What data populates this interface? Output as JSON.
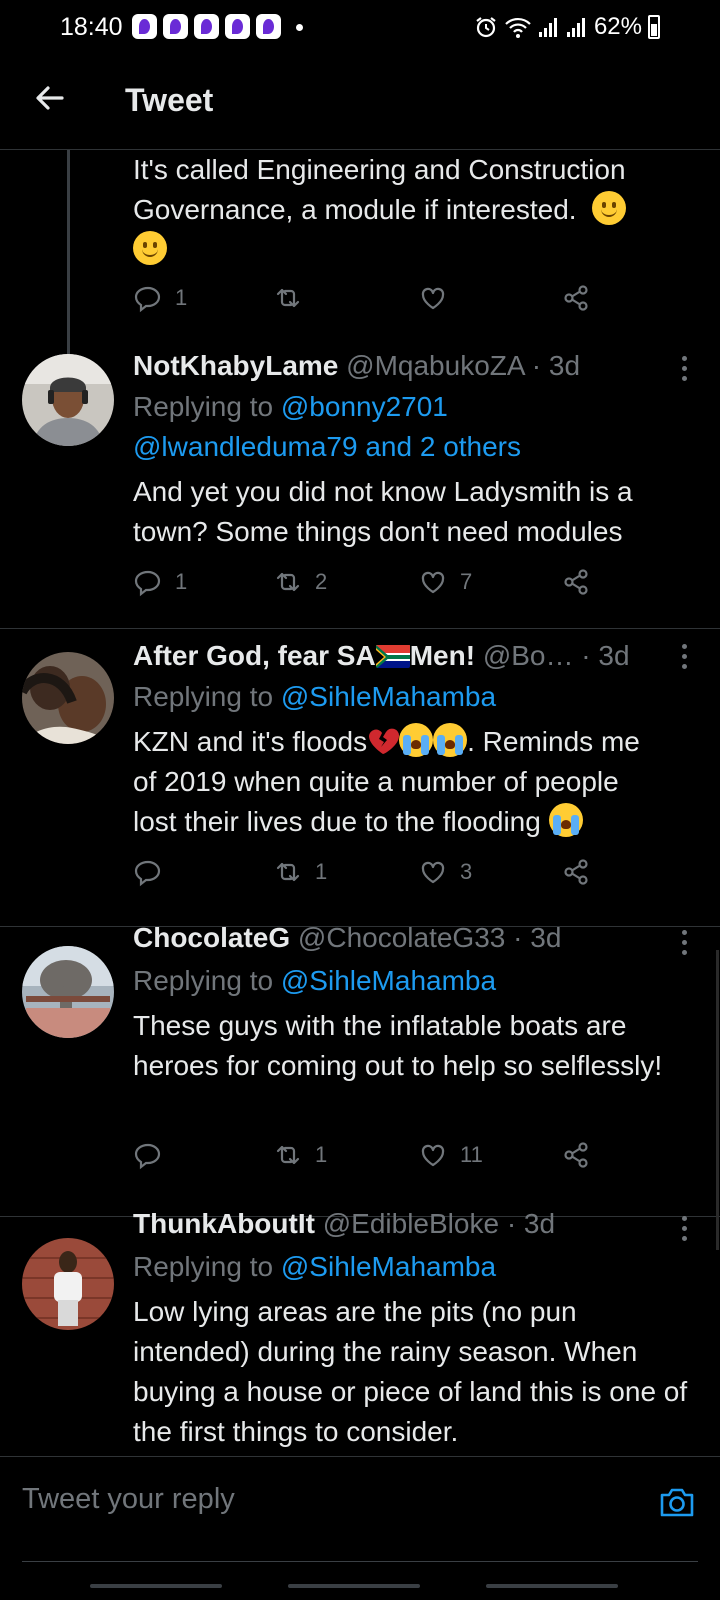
{
  "status_bar": {
    "time": "18:40",
    "battery": "62%",
    "icons": [
      "p-app-icon",
      "p-app-icon",
      "p-app-icon",
      "p-app-icon",
      "p-app-icon",
      "alarm-icon",
      "wifi-icon",
      "signal-icon",
      "signal-icon",
      "battery-icon"
    ]
  },
  "header": {
    "title": "Tweet",
    "back_icon": "arrow-left-icon"
  },
  "tweets": [
    {
      "text_line1": "It's called Engineering and Construction",
      "text_line2": "Governance, a module if interested.",
      "reply_count": "1",
      "retweet_count": "",
      "like_count": ""
    },
    {
      "name": "NotKhabyLame",
      "handle": "@MqabukoZA",
      "time": "· 3d",
      "replying_label": "Replying to",
      "replying_to_1": "@bonny2701",
      "replying_to_2": "@lwandleduma79 and 2 others",
      "text": "And yet you did not know Ladysmith is a town? Some things don't need modules",
      "reply_count": "1",
      "retweet_count": "2",
      "like_count": "7"
    },
    {
      "name_part1": "After God, fear SA",
      "name_part2": "Men!",
      "handle": "@Bo…",
      "time": "· 3d",
      "replying_label": "Replying to",
      "replying_to": "@SihleMahamba",
      "text_part1": "KZN and it's floods",
      "text_part2": ". Reminds me",
      "text_part3": "of 2019 when quite a number of people",
      "text_part4": "lost their lives due to the flooding",
      "reply_count": "",
      "retweet_count": "1",
      "like_count": "3"
    },
    {
      "name": "ChocolateG",
      "handle": "@ChocolateG33",
      "time": "· 3d",
      "replying_label": "Replying to",
      "replying_to": "@SihleMahamba",
      "text": "These guys with the inflatable boats are heroes for coming out to help so selflessly!",
      "reply_count": "",
      "retweet_count": "1",
      "like_count": "11"
    },
    {
      "name": "ThunkAboutIt",
      "handle": "@EdibleBloke",
      "time": "· 3d",
      "replying_label": "Replying to",
      "replying_to": "@SihleMahamba",
      "text": "Low lying areas are the pits (no pun intended) during the rainy season. When buying a house or piece of land this is one of the first things to consider."
    }
  ],
  "reply_bar": {
    "placeholder": "Tweet your reply",
    "camera_icon": "camera-icon"
  },
  "colors": {
    "background": "#000000",
    "text": "#e7e9ea",
    "muted": "#71767b",
    "link": "#1d9bf0",
    "divider": "#2f3336"
  }
}
